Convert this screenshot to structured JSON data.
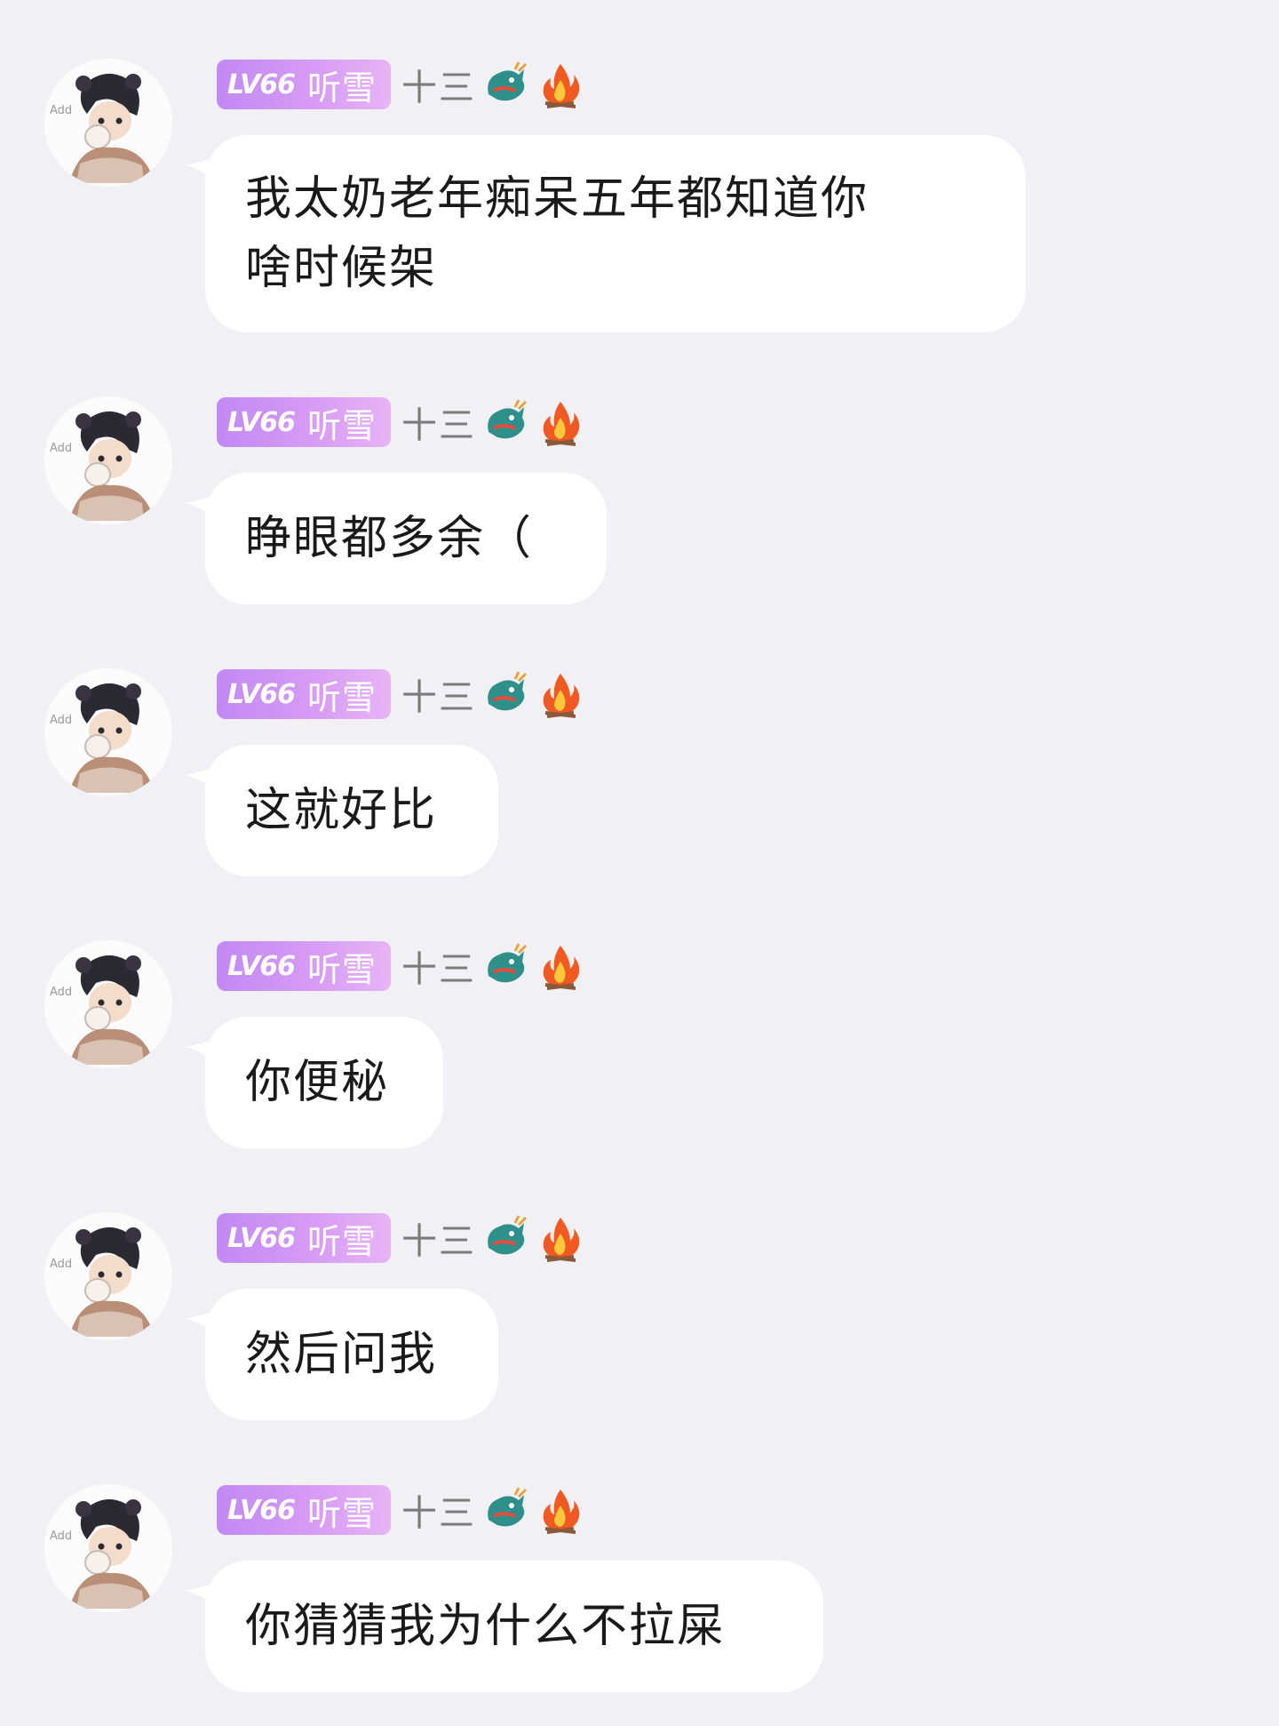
{
  "messages": [
    {
      "level": "LV66",
      "title": "听雪",
      "username": "十三",
      "text": "我太奶老年痴呆五年都知道你\n啥时候架"
    },
    {
      "level": "LV66",
      "title": "听雪",
      "username": "十三",
      "text": "睁眼都多余（"
    },
    {
      "level": "LV66",
      "title": "听雪",
      "username": "十三",
      "text": "这就好比"
    },
    {
      "level": "LV66",
      "title": "听雪",
      "username": "十三",
      "text": "你便秘"
    },
    {
      "level": "LV66",
      "title": "听雪",
      "username": "十三",
      "text": "然后问我"
    },
    {
      "level": "LV66",
      "title": "听雪",
      "username": "十三",
      "text": "你猜猜我为什么不拉屎"
    }
  ],
  "icons": {
    "badge_left": "dragon-icon",
    "badge_right": "fire-icon"
  },
  "colors": {
    "background": "#f1f0f4",
    "bubble": "#ffffff",
    "level_badge_start": "#c189f5",
    "level_badge_end": "#e7b4f5",
    "username": "#7b7b7b",
    "message_text": "#1a1a1a"
  }
}
